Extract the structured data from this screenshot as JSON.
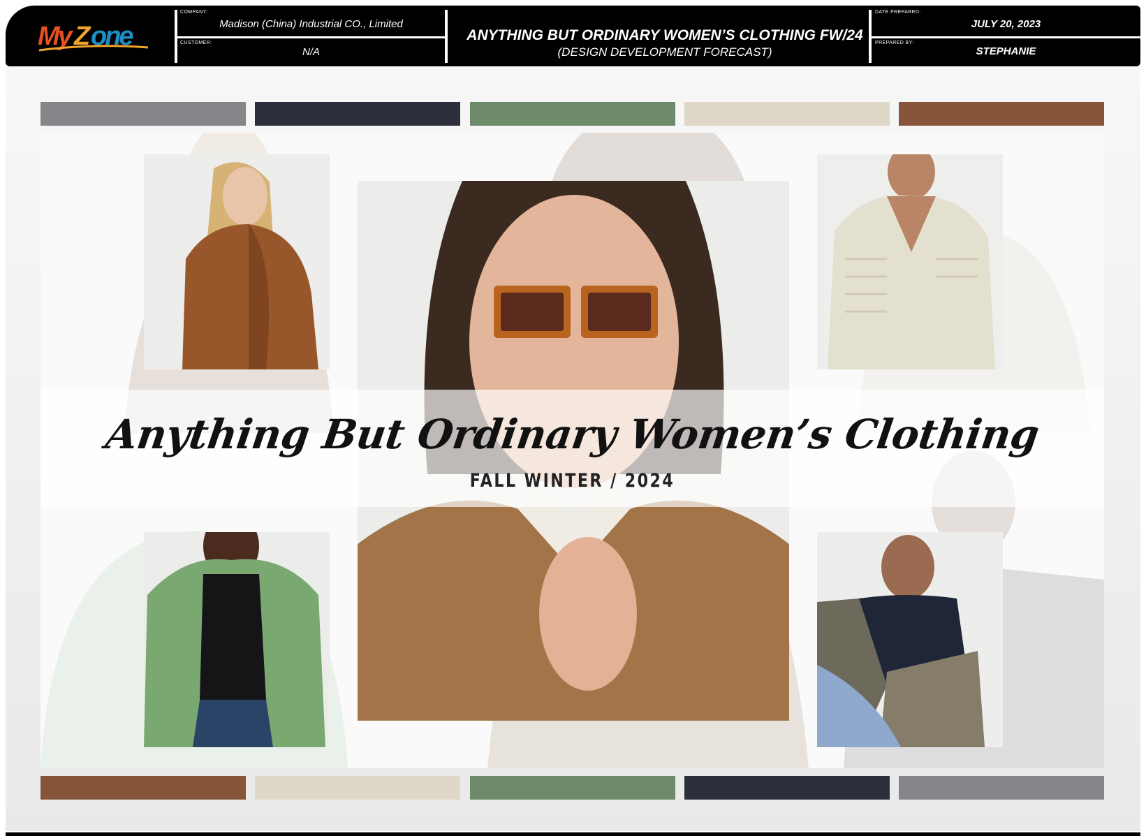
{
  "header": {
    "company_label": "COMPANY:",
    "company": "Madison (China) Industrial CO., Limited",
    "customer_label": "CUSTOMER:",
    "customer": "N/A",
    "title": "ANYTHING BUT ORDINARY WOMEN’S CLOTHING FW/24",
    "subtitle": "(DESIGN DEVELOPMENT FORECAST)",
    "date_label": "DATE PREPARED:",
    "date": "JULY 20, 2023",
    "prepared_by_label": "PREPARED BY:",
    "prepared_by": "STEPHANIE"
  },
  "logo": {
    "text": "MyZone",
    "colors": [
      "#e8501f",
      "#f0a52a",
      "#1c8fc4"
    ]
  },
  "palette_top": [
    "#858689",
    "#2d2e3c",
    "#6d8a6a",
    "#dfd8c9",
    "#87553a"
  ],
  "palette_bottom": [
    "#87553a",
    "#dfd8c9",
    "#6d8a6a",
    "#2d2e3c",
    "#858689"
  ],
  "board": {
    "title": "Anything But Ordinary Women’s Clothing",
    "season": "FALL WINTER / 2024"
  },
  "photos": [
    {
      "name": "brown-bomber-jacket-photo",
      "icon": "model-photo"
    },
    {
      "name": "sunglasses-suede-shirt-photo",
      "icon": "model-photo"
    },
    {
      "name": "cream-ribbed-sweater-photo",
      "icon": "model-photo"
    },
    {
      "name": "green-hoodie-cardigan-photo",
      "icon": "model-photo"
    },
    {
      "name": "colorblock-sweater-photo",
      "icon": "model-photo"
    }
  ]
}
